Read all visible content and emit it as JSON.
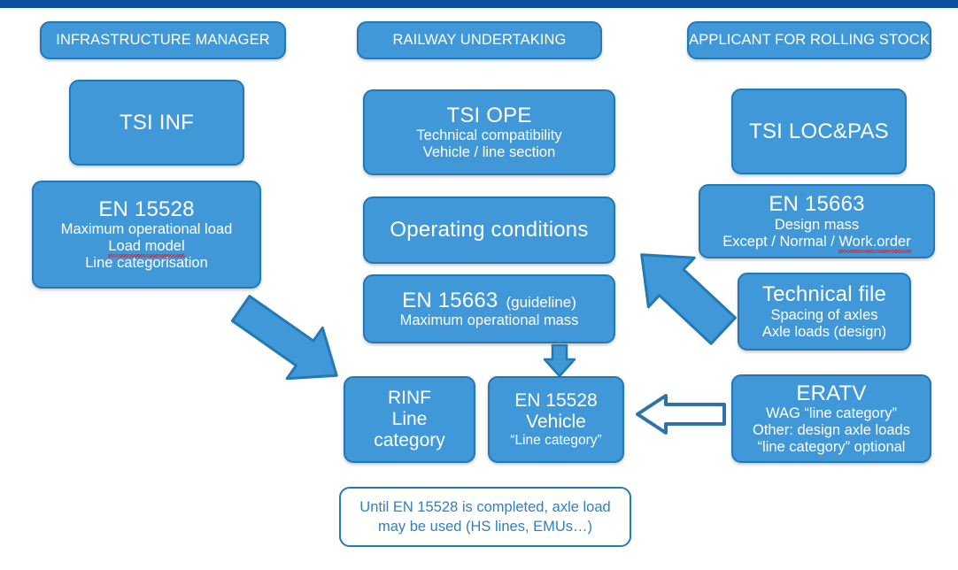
{
  "theme": {
    "topbar_color": "#0b4f9e",
    "box_fill": "#4098d9",
    "box_border": "#2379b4",
    "box_text": "#ffffff",
    "note_text": "#2f7fc1",
    "spellcheck_underline": "#e02020"
  },
  "columns": {
    "infrastructure_manager": {
      "header": "INFRASTRUCTURE MANAGER",
      "boxes": {
        "tsi_inf": {
          "title": "TSI INF"
        },
        "en15528": {
          "title": "EN 15528",
          "line1": "Maximum operational load",
          "line2": "Load model",
          "line3": "Line categorisation"
        }
      }
    },
    "railway_undertaking": {
      "header": "RAILWAY UNDERTAKING",
      "boxes": {
        "tsi_ope": {
          "title": "TSI OPE",
          "line1": "Technical  compatibility",
          "line2": "Vehicle / line section"
        },
        "operating_conditions": {
          "title": "Operating conditions"
        },
        "en15663": {
          "title": "EN 15663",
          "note": "(guideline)",
          "line1": "Maximum operational mass"
        },
        "rinf": {
          "line1": "RINF",
          "line2": "Line",
          "line3": "category"
        },
        "en15528_vehicle": {
          "line1": "EN 15528",
          "line2": "Vehicle",
          "line3": "“Line category”"
        }
      },
      "note": {
        "line1": "Until EN 15528 is completed, axle load",
        "line2": "may be used (HS lines, EMUs…)"
      }
    },
    "applicant_rolling_stock": {
      "header": "APPLICANT FOR ROLLING STOCK",
      "boxes": {
        "tsi_loc_pas": {
          "title": "TSI LOC&PAS"
        },
        "en15663": {
          "title": "EN 15663",
          "line1": "Design mass",
          "line2a": "Except / Normal / ",
          "line2b": "Work.order"
        },
        "technical_file": {
          "title": "Technical file",
          "line1": "Spacing of axles",
          "line2": "Axle loads (design)"
        },
        "eratv": {
          "title": "ERATV",
          "line1": "WAG “line category”",
          "line2": "Other: design axle loads",
          "line3": "“line category” optional"
        }
      }
    }
  },
  "arrows": {
    "im_to_rinf": "arrow-diagonal-down-right",
    "applicant_to_ru": "arrow-diagonal-up-left",
    "en15663_to_en15528_vehicle": "arrow-down-small",
    "eratv_to_en15528_vehicle": "arrow-left-hollow"
  }
}
